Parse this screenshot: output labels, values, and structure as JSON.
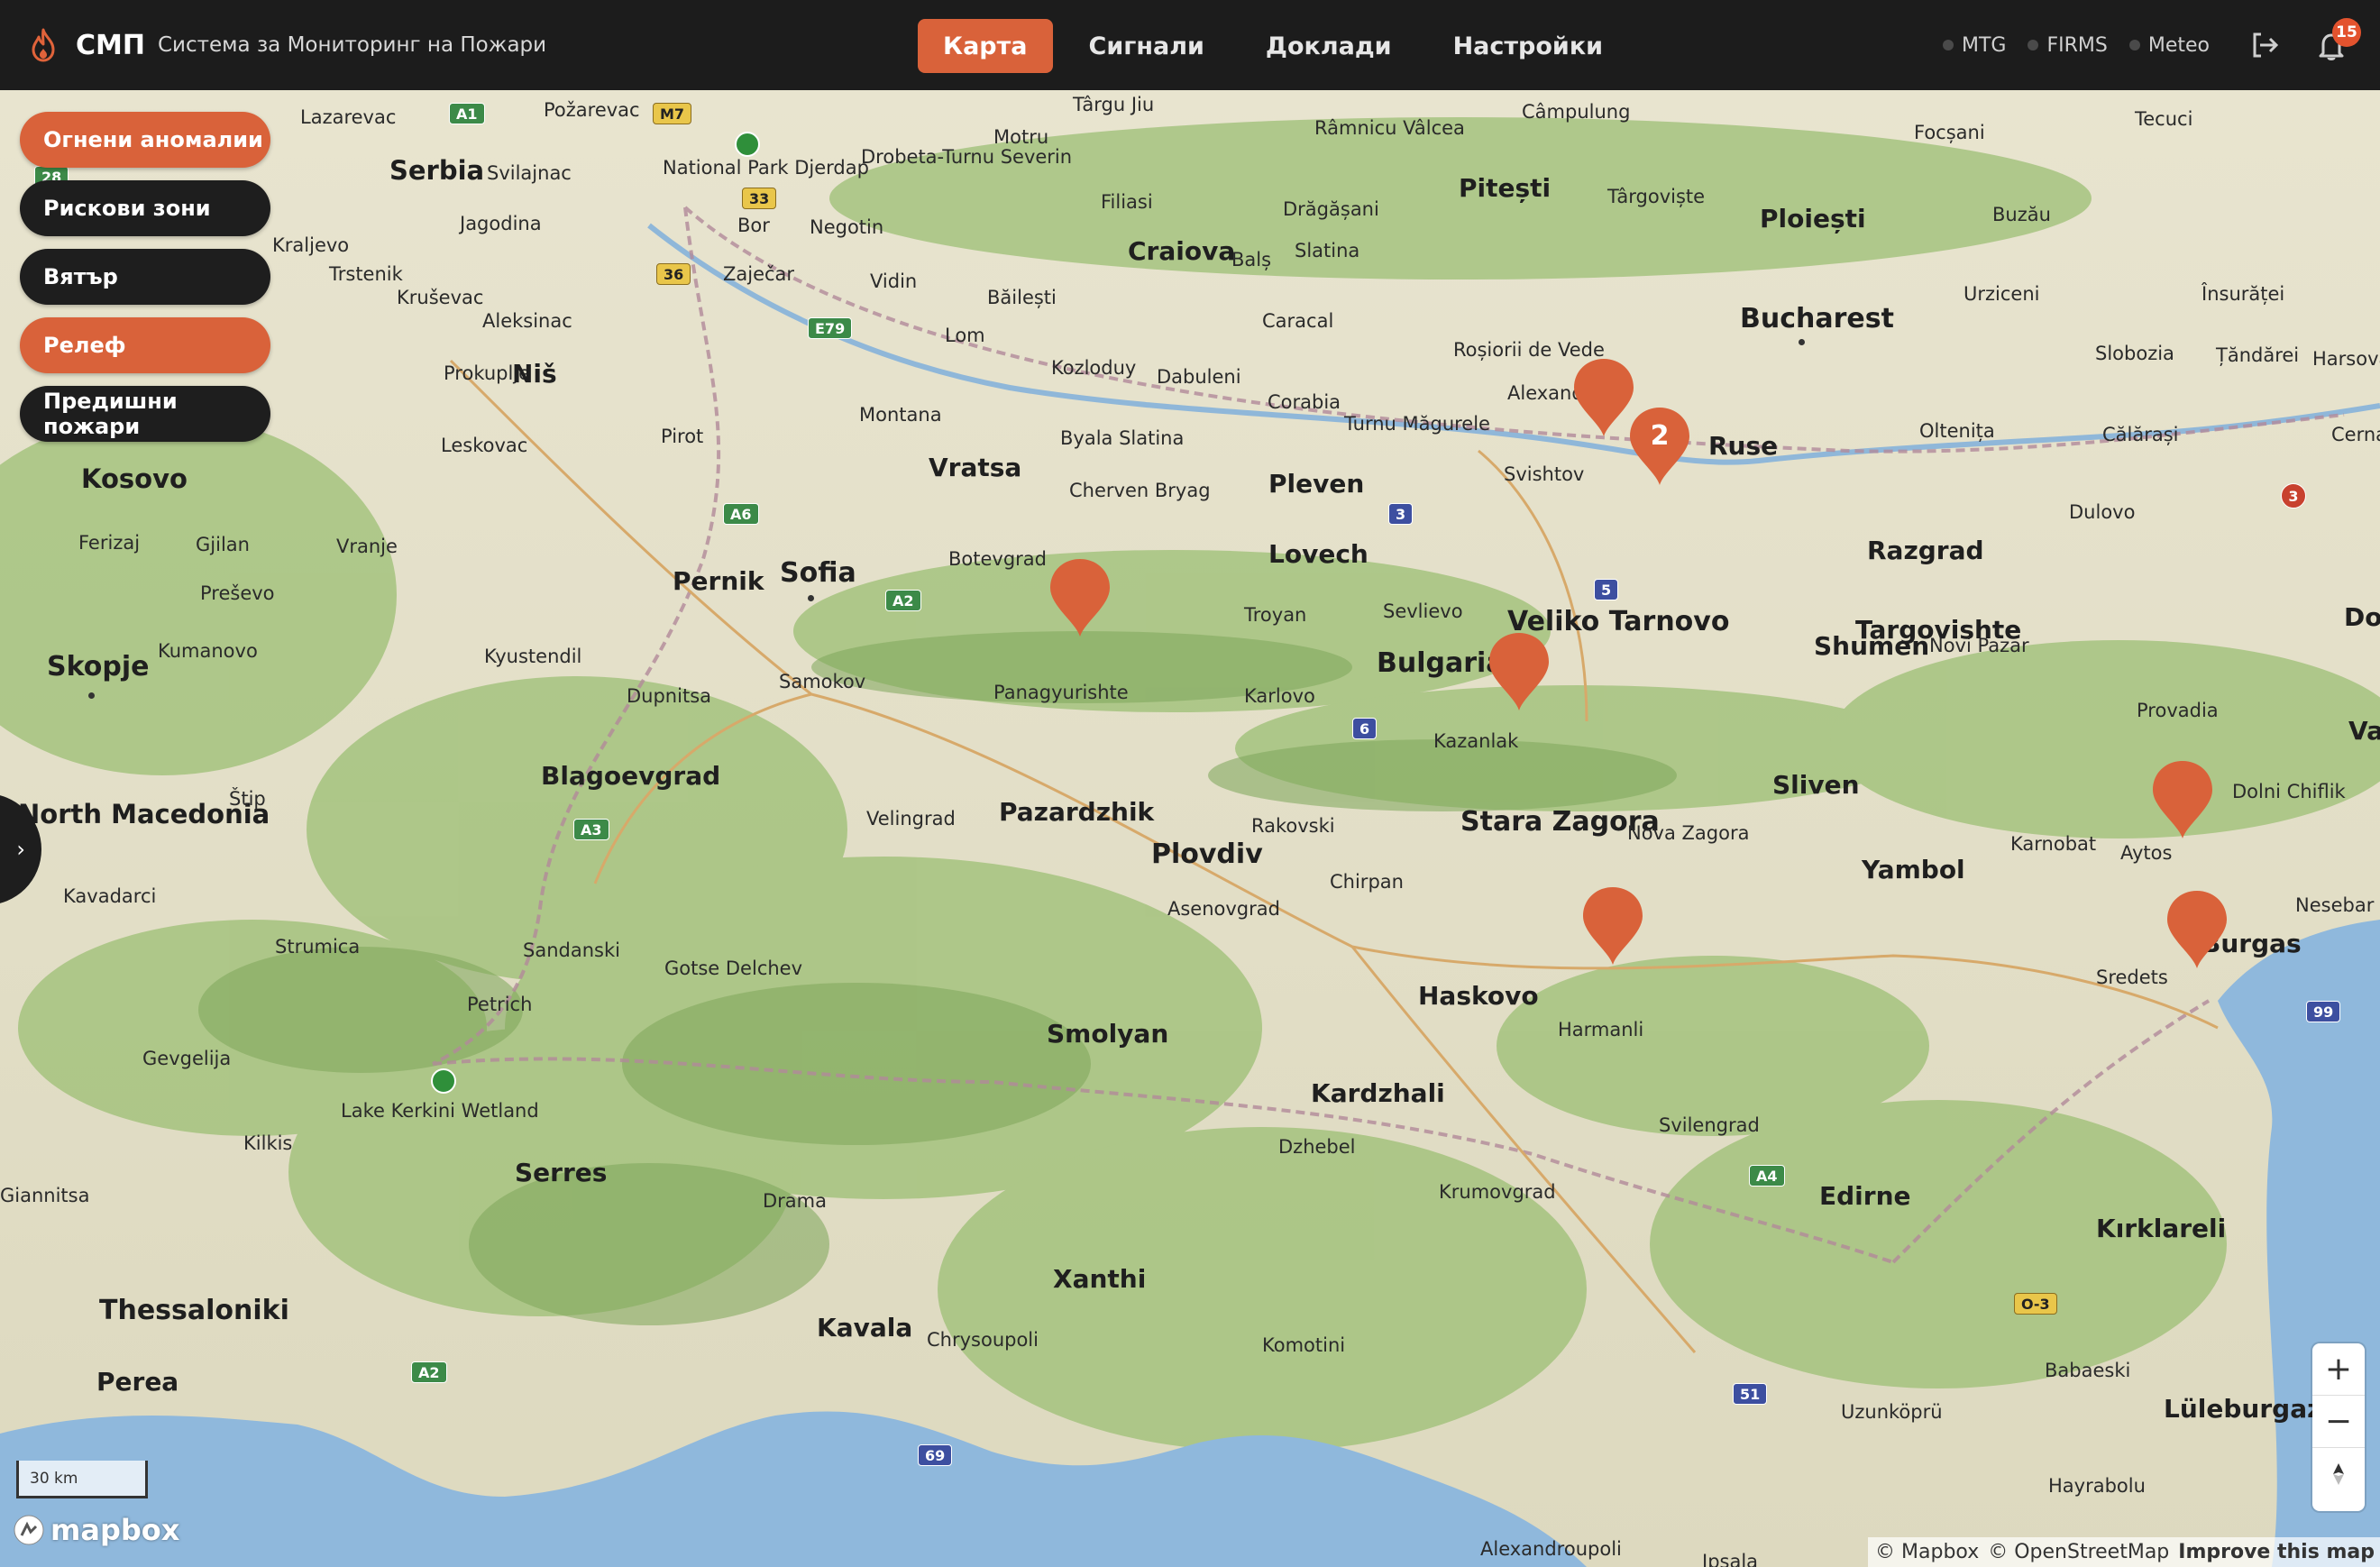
{
  "header": {
    "brand_short": "СМП",
    "brand_full": "Система за Мониторинг на Пожари",
    "tabs": [
      {
        "label": "Карта",
        "active": true
      },
      {
        "label": "Сигнали",
        "active": false
      },
      {
        "label": "Доклади",
        "active": false
      },
      {
        "label": "Настройки",
        "active": false
      }
    ],
    "sources": [
      {
        "label": "MTG"
      },
      {
        "label": "FIRMS"
      },
      {
        "label": "Meteo"
      }
    ],
    "notification_count": "15",
    "accent_color": "#d9623a"
  },
  "layers": [
    {
      "label": "Огнени аномалии",
      "active": true
    },
    {
      "label": "Рискови зони",
      "active": false
    },
    {
      "label": "Вятър",
      "active": false
    },
    {
      "label": "Релеф",
      "active": true
    },
    {
      "label": "Предишни пожари",
      "active": false
    }
  ],
  "map": {
    "countries": [
      "Serbia",
      "Kosovo",
      "Bulgaria",
      "North Macedonia"
    ],
    "capitals": [
      "Sofia",
      "Bucharest",
      "Skopje"
    ],
    "cities": [
      "Lazarevac",
      "Požarevac",
      "Târgu Jiu",
      "Râmnicu Vâlcea",
      "Câmpulung",
      "Focșani",
      "Tecuci",
      "Drobeta-Turnu Severin",
      "Motru",
      "Filiasi",
      "Drăgășani",
      "Pitești",
      "Târgoviște",
      "Ploiești",
      "Buzău",
      "Svilajnac",
      "Negotin",
      "Bor",
      "Zaječar",
      "Jagodina",
      "Kraljevo",
      "Trstenik",
      "Kruševac",
      "Aleksinac",
      "Craiova",
      "Balș",
      "Slatina",
      "Vidin",
      "Băilești",
      "Caracal",
      "Urziceni",
      "Însurăței",
      "Lom",
      "Kozloduy",
      "Dabuleni",
      "Roșiorii de Vede",
      "Alexandria",
      "Slobozia",
      "Țăndărei",
      "Harsova",
      "Prokuplje",
      "Niš",
      "Montana",
      "Corabia",
      "Turnu Măgurele",
      "Oltenița",
      "Călărași",
      "Cerna",
      "Leskovac",
      "Pirot",
      "Byala Slatina",
      "Svishtov",
      "Ruse",
      "Vratsa",
      "Cherven Bryag",
      "Pleven",
      "Dulovo",
      "Ferizaj",
      "Gjilan",
      "Vranje",
      "Botevgrad",
      "Lovech",
      "Razgrad",
      "Preševo",
      "Pernik",
      "Troyan",
      "Sevlievo",
      "Veliko Tarnovo",
      "Targovishte",
      "Dobrich",
      "Kumanovo",
      "Kyustendil",
      "Samokov",
      "Shumen",
      "Novi Pazar",
      "Dupnitsa",
      "Panagyurishte",
      "Karlovo",
      "Kazanlak",
      "Provadia",
      "Varna",
      "Štip",
      "Blagoevgrad",
      "Sliven",
      "Dolni Chiflik",
      "Velingrad",
      "Pazardzhik",
      "Rakovski",
      "Stara Zagora",
      "Nova Zagora",
      "Karnobat",
      "Aytos",
      "Plovdiv",
      "Kavadarci",
      "Chirpan",
      "Yambol",
      "Strumica",
      "Sandanski",
      "Asenovgrad",
      "Nesebar",
      "Gotse Delchev",
      "Burgas",
      "Petrich",
      "Haskovo",
      "Sredets",
      "Harmanli",
      "Gevgelija",
      "Smolyan",
      "Kardzhali",
      "Lake Kerkini Wetland",
      "Svilengrad",
      "Kilkis",
      "Dzhebel",
      "Serres",
      "Krumovgrad",
      "Edirne",
      "Kırklareli",
      "Giannitsa",
      "Drama",
      "Xanthi",
      "Thessaloniki",
      "Kavala",
      "Chrysoupoli",
      "Komotini",
      "Babaeski",
      "Perea",
      "Uzunköprü",
      "Lüleburgaz",
      "Hayrabolu",
      "Alexandroupoli",
      "National Park Djerdap",
      "Ipsala"
    ],
    "roads": [
      "A1",
      "M7",
      "33",
      "36",
      "E79",
      "A6",
      "A2",
      "A3",
      "3",
      "5",
      "6",
      "A4",
      "O-3",
      "A2",
      "51",
      "69",
      "99",
      "28",
      "3"
    ],
    "scale_label": "30 km",
    "markers": [
      {
        "count": ""
      },
      {
        "count": "2"
      },
      {
        "count": ""
      },
      {
        "count": ""
      },
      {
        "count": ""
      },
      {
        "count": ""
      },
      {
        "count": ""
      }
    ],
    "marker_color": "#d9623a",
    "attribution": {
      "mapbox": "© Mapbox",
      "osm": "© OpenStreetMap",
      "improve": "Improve this map"
    },
    "logo": "mapbox"
  }
}
